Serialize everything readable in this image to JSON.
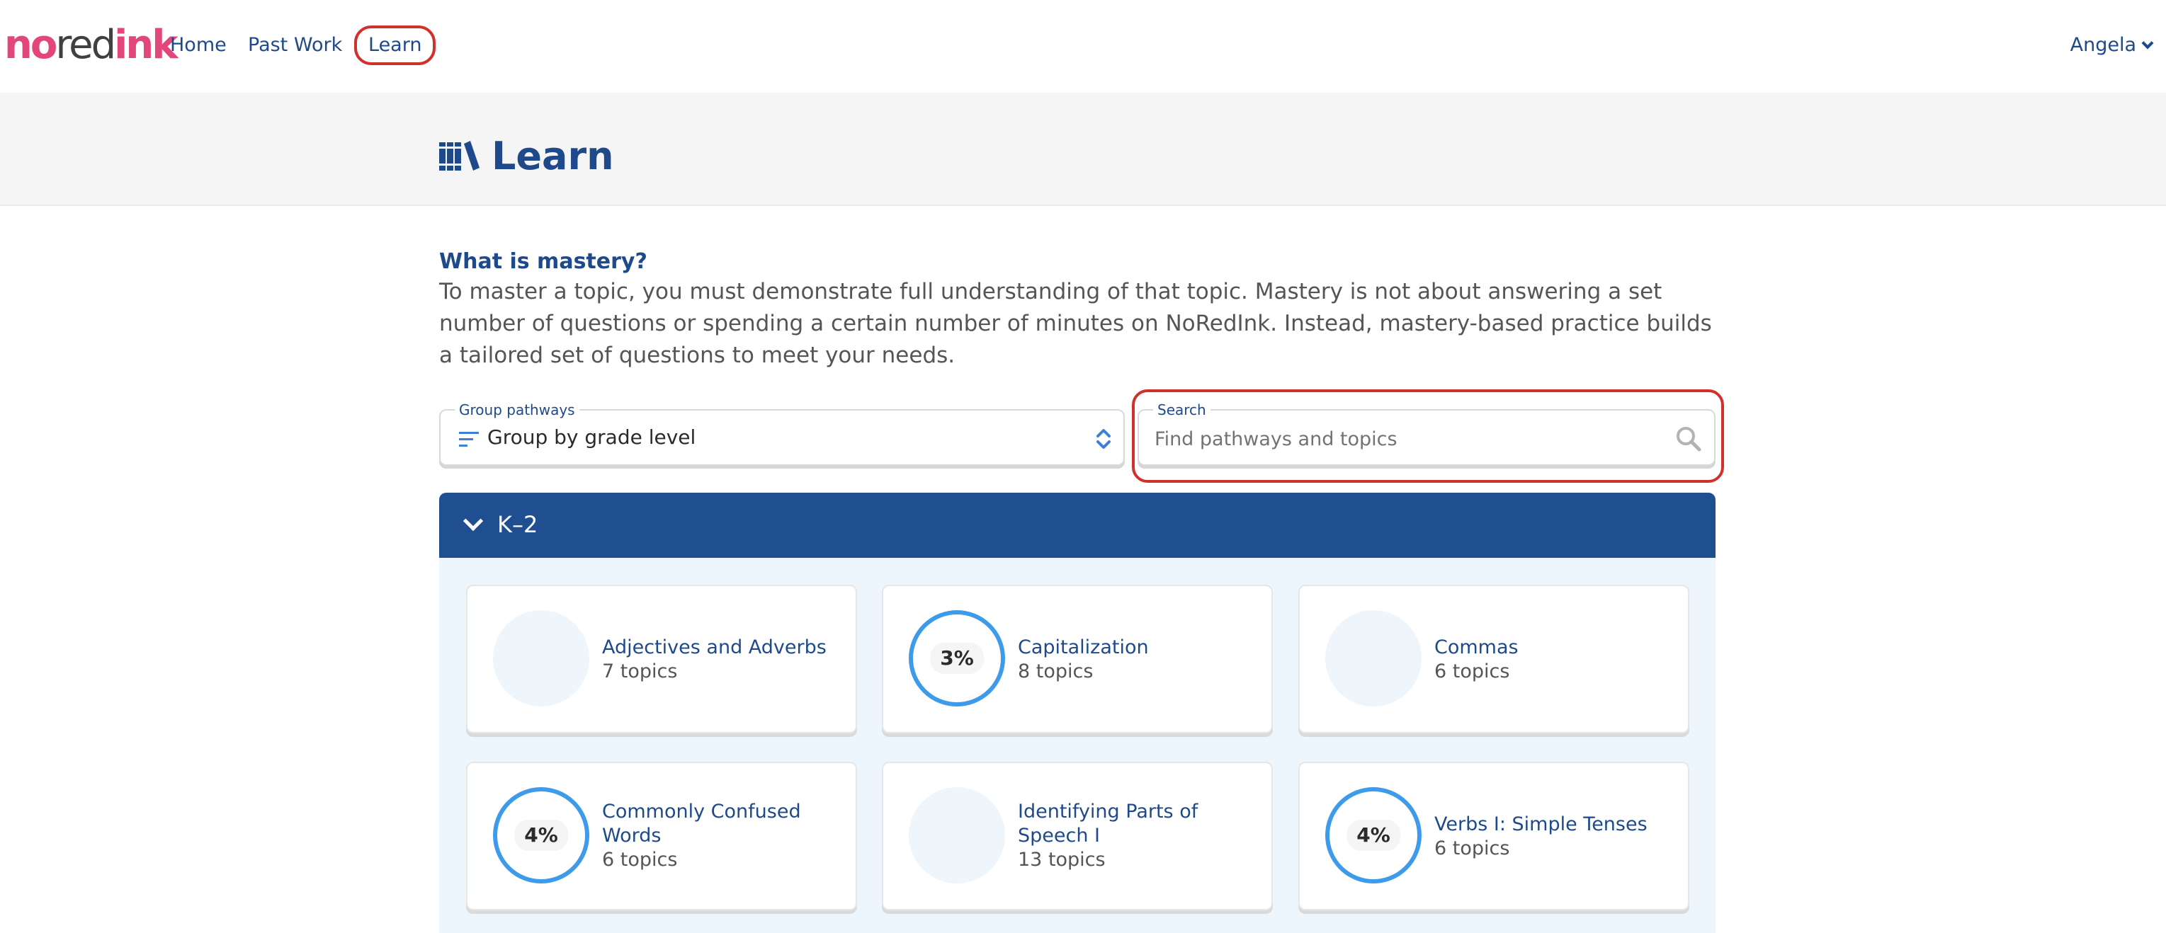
{
  "logo": {
    "no": "no",
    "red": "red",
    "ink": "ink"
  },
  "nav": {
    "home": "Home",
    "past_work": "Past Work",
    "learn": "Learn",
    "user": "Angela"
  },
  "page": {
    "title": "Learn"
  },
  "mastery": {
    "heading": "What is mastery?",
    "text": "To master a topic, you must demonstrate full understanding of that topic. Mastery is not about answering a set number of questions or spending a certain number of minutes on NoRedInk. Instead, mastery-based practice builds a tailored set of questions to meet your needs."
  },
  "group": {
    "label": "Group pathways",
    "value": "Group by grade level"
  },
  "search": {
    "label": "Search",
    "placeholder": "Find pathways and topics"
  },
  "section": {
    "title": "K–2"
  },
  "cards": [
    {
      "title": "Adjectives and Adverbs",
      "subtitle": "7 topics",
      "percent": "",
      "progress": 0
    },
    {
      "title": "Capitalization",
      "subtitle": "8 topics",
      "percent": "3%",
      "progress": 3
    },
    {
      "title": "Commas",
      "subtitle": "6 topics",
      "percent": "",
      "progress": 0
    },
    {
      "title": "Commonly Confused Words",
      "subtitle": "6 topics",
      "percent": "4%",
      "progress": 4
    },
    {
      "title": "Identifying Parts of Speech I",
      "subtitle": "13 topics",
      "percent": "",
      "progress": 0
    },
    {
      "title": "Verbs I: Simple Tenses",
      "subtitle": "6 topics",
      "percent": "4%",
      "progress": 4
    }
  ],
  "colors": {
    "brand_pink": "#e3467a",
    "navy": "#1e4a8c",
    "section_blue": "#1f4e91",
    "progress_blue": "#3d9be9",
    "highlight_red": "#d0312d"
  }
}
